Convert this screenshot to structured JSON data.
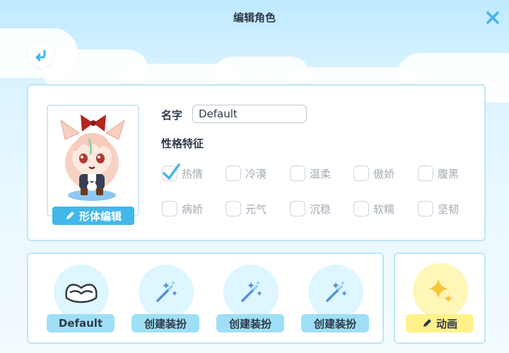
{
  "header": {
    "title": "编辑角色",
    "close_icon": "close-icon",
    "back_icon": "back-arrow-icon",
    "accent_color": "#41b7ea"
  },
  "character": {
    "avatar_icon": "character-avatar",
    "edit_body_label": "形体编辑",
    "edit_icon": "pencil-icon",
    "name_label": "名字",
    "name_value": "Default",
    "traits_label": "性格特征",
    "traits": [
      {
        "label": "热情",
        "checked": true
      },
      {
        "label": "冷漠",
        "checked": false
      },
      {
        "label": "温柔",
        "checked": false
      },
      {
        "label": "傲娇",
        "checked": false
      },
      {
        "label": "腹黑",
        "checked": false
      },
      {
        "label": "病娇",
        "checked": false
      },
      {
        "label": "元气",
        "checked": false
      },
      {
        "label": "沉稳",
        "checked": false
      },
      {
        "label": "软糯",
        "checked": false
      },
      {
        "label": "坚韧",
        "checked": false
      }
    ]
  },
  "outfits": {
    "slots": [
      {
        "label": "Default",
        "icon": "folded-cloth-icon"
      },
      {
        "label": "创建装扮",
        "icon": "magic-wand-icon"
      },
      {
        "label": "创建装扮",
        "icon": "magic-wand-icon"
      },
      {
        "label": "创建装扮",
        "icon": "magic-wand-icon"
      }
    ]
  },
  "animation": {
    "label": "动画",
    "icon": "sparkle-icon",
    "edit_icon": "pencil-icon"
  }
}
